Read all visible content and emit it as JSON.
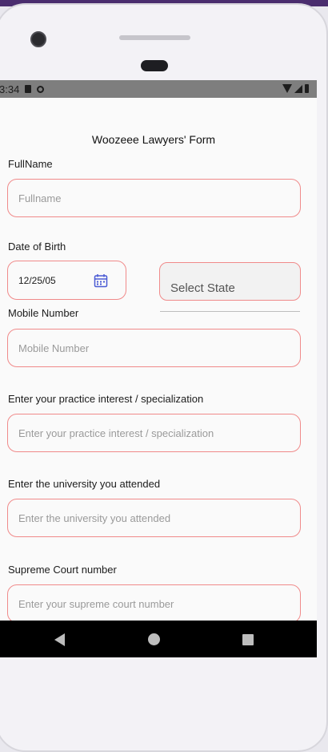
{
  "status_bar": {
    "time": "3:34"
  },
  "form": {
    "title": "Woozeee Lawyers' Form",
    "fullname": {
      "label": "FullName",
      "placeholder": "Fullname"
    },
    "dob": {
      "label": "Date of Birth",
      "value": "12/25/05"
    },
    "state": {
      "placeholder": "Select State"
    },
    "mobile": {
      "label": "Mobile Number",
      "placeholder": "Mobile Number"
    },
    "practice": {
      "label": "Enter your practice interest / specialization",
      "placeholder": "Enter your practice interest / specialization"
    },
    "university": {
      "label": "Enter the university you attended",
      "placeholder": "Enter the university you attended"
    },
    "court": {
      "label": "Supreme Court number",
      "placeholder": "Enter your supreme court number"
    }
  },
  "icons": {
    "calendar": "calendar-icon",
    "back": "back-triangle-icon",
    "home": "home-circle-icon",
    "recents": "recents-square-icon"
  },
  "colors": {
    "field_border": "#f08a8a",
    "calendar_icon": "#4a5bd4"
  }
}
